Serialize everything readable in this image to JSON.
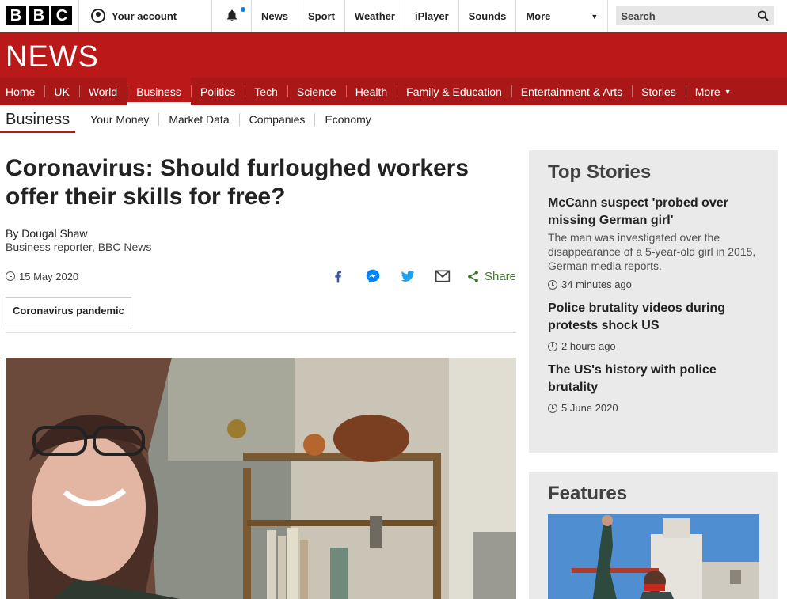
{
  "globalnav": {
    "brand": [
      "B",
      "B",
      "C"
    ],
    "account_label": "Your account",
    "items": [
      "News",
      "Sport",
      "Weather",
      "iPlayer",
      "Sounds"
    ],
    "more_label": "More",
    "search_placeholder": "Search"
  },
  "banner": {
    "wordmark": "NEWS"
  },
  "sections": {
    "items": [
      "Home",
      "UK",
      "World",
      "Business",
      "Politics",
      "Tech",
      "Science",
      "Health",
      "Family & Education",
      "Entertainment & Arts",
      "Stories"
    ],
    "more_label": "More",
    "active": "Business"
  },
  "subnav": {
    "title": "Business",
    "items": [
      "Your Money",
      "Market Data",
      "Companies",
      "Economy"
    ]
  },
  "article": {
    "headline": "Coronavirus: Should furloughed workers offer their skills for free?",
    "author": "By Dougal Shaw",
    "role": "Business reporter, BBC News",
    "date": "15 May 2020",
    "share_label": "Share",
    "tag": "Coronavirus pandemic"
  },
  "sidebar": {
    "top_stories_heading": "Top Stories",
    "stories": [
      {
        "title": "McCann suspect 'probed over missing German girl'",
        "summary": "The man was investigated over the disappearance of a 5-year-old girl in 2015, German media reports.",
        "time": "34 minutes ago"
      },
      {
        "title": "Police brutality videos during protests shock US",
        "summary": "",
        "time": "2 hours ago"
      },
      {
        "title": "The US's history with police brutality",
        "summary": "",
        "time": "5 June 2020"
      }
    ],
    "features_heading": "Features"
  },
  "colors": {
    "brand_red": "#bb1919",
    "nav_red": "#a91717",
    "share_green": "#3a7a24",
    "facebook": "#3b5998",
    "messenger": "#0084ff",
    "twitter": "#1da1f2"
  }
}
